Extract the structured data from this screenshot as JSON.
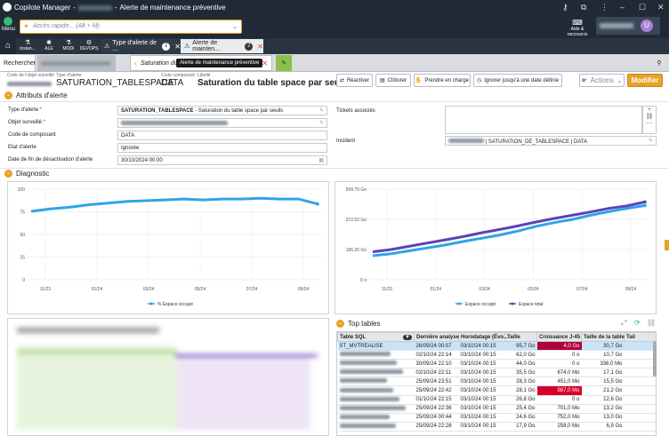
{
  "window": {
    "app_name": "Copilote Manager",
    "title_sep": "-",
    "title": "Alerte de maintenance préventive",
    "controls": [
      "–",
      "☐",
      "✕"
    ]
  },
  "topbar": {
    "menu_label": "Menu",
    "search_placeholder": "Accès rapide... (Alt + M)",
    "aide_label": "Aide & raccourcis",
    "avatar_letter": "U"
  },
  "app_tabs": [
    {
      "label": "Instan...",
      "icon": "⚗"
    },
    {
      "label": "ALE",
      "icon": "✱"
    },
    {
      "label": "MODI",
      "icon": "⚗"
    },
    {
      "label": "DEVOPS",
      "icon": "⚙"
    }
  ],
  "doc_tabs": [
    {
      "label": "Type d'alerte de ...",
      "count": "1"
    },
    {
      "label": "Alerte de mainten...",
      "count": "2"
    }
  ],
  "nav": {
    "search_tab": "Rechercher",
    "current_tab": "Saturation du",
    "tooltip": "Alerte de maintenance préventive"
  },
  "header": {
    "code_label": "Code de l'objet surveillé",
    "type_label": "Type d'alerte",
    "type_value": "SATURATION_TABLESPACE",
    "component_label": "Code composant",
    "component_value": "DATA",
    "libelle_label": "Libellé",
    "libelle_value": "Saturation du table space par seuils"
  },
  "actions": {
    "reactiver": "Réactiver",
    "cloturer": "Clôturer",
    "prendre": "Prendre en charge",
    "ignorer": "Ignorer jusqu'à une date définie",
    "actions": "Actions",
    "modifier": "Modifier"
  },
  "attributs": {
    "section_title": "Attributs d'alerte",
    "type_label": "Type d'alerte",
    "type_code": "SATURATION_TABLESPACE",
    "type_desc": " - Saturation du table space par seuils",
    "objet_label": "Objet surveillé",
    "composant_label": "Code de composant",
    "composant_value": "DATA",
    "etat_label": "Etat d'alerte",
    "etat_value": "Ignorée",
    "date_label": "Date de fin de désactivation d'alerte",
    "date_value": "30/10/2024 00:00",
    "tickets_label": "Tickets associés",
    "incident_label": "Incident",
    "incident_value": " | SATURATION_DE_TABLESPACE | DATA"
  },
  "diagnostic": {
    "section_title": "Diagnostic"
  },
  "chart_data": [
    {
      "type": "line",
      "x": [
        "11/23",
        "01/24",
        "03/24",
        "05/24",
        "07/24",
        "09/24"
      ],
      "series": [
        {
          "name": "% Espace occupé",
          "color": "#2fa3e8",
          "values": [
            83,
            86,
            88,
            91,
            93,
            95,
            96,
            97,
            98,
            97,
            98,
            98,
            99,
            98,
            98,
            92
          ]
        }
      ],
      "yticks": [
        "0",
        "25",
        "50",
        "75",
        "100"
      ],
      "ylim": [
        0,
        110
      ],
      "grid": true,
      "legend": "bottom"
    },
    {
      "type": "line",
      "x": [
        "11/23",
        "01/24",
        "03/24",
        "05/24",
        "07/24",
        "09/24"
      ],
      "series": [
        {
          "name": "Espace occupé",
          "color": "#2fa3e8",
          "values": [
            148,
            160,
            178,
            196,
            214,
            236,
            256,
            276,
            300,
            330,
            352,
            372,
            398,
            420,
            440,
            458
          ]
        },
        {
          "name": "Espace total",
          "color": "#5b43b9",
          "values": [
            172,
            186,
            206,
            226,
            246,
            266,
            290,
            310,
            332,
            356,
            378,
            398,
            418,
            440,
            456,
            480
          ]
        }
      ],
      "yticks": [
        "0 o",
        "186.26 Go",
        "372.53 Go",
        "558.79 Go"
      ],
      "ylim": [
        0,
        558.79
      ],
      "grid": true,
      "legend": "bottom"
    }
  ],
  "top_tables": {
    "section_title": "Top tables",
    "columns": [
      "Table SQL",
      "Dernière analyse",
      "Horodatage (Évo...",
      "Taille",
      "Croissance J-45",
      "Taille de la table",
      "Tail"
    ],
    "rows": [
      {
        "name": "ST_MVTREALISE",
        "d1": "26/09/24 00:07",
        "d2": "03/10/24 00:15",
        "taille": "95,7 Go",
        "croissance": "4,0 Go",
        "table": "30,7 Go",
        "hl": "darkred"
      },
      {
        "name": "",
        "d1": "02/10/24 22:14",
        "d2": "03/10/24 00:15",
        "taille": "62,0 Go",
        "croissance": "0 o",
        "table": "10,7 Go",
        "hl": ""
      },
      {
        "name": "",
        "d1": "30/09/24 22:10",
        "d2": "03/10/24 00:15",
        "taille": "44,0 Go",
        "croissance": "0 o",
        "table": "336,0 Mo",
        "hl": ""
      },
      {
        "name": "",
        "d1": "02/10/24 22:11",
        "d2": "03/10/24 00:15",
        "taille": "35,5 Go",
        "croissance": "674,0 Mo",
        "table": "17,1 Go",
        "hl": ""
      },
      {
        "name": "",
        "d1": "25/09/24 23:51",
        "d2": "03/10/24 00:15",
        "taille": "28,3 Go",
        "croissance": "451,0 Mo",
        "table": "15,5 Go",
        "hl": ""
      },
      {
        "name": "",
        "d1": "25/09/24 22:42",
        "d2": "03/10/24 00:15",
        "taille": "28,1 Go",
        "croissance": "987,0 Mo",
        "table": "21,2 Go",
        "hl": "red"
      },
      {
        "name": "",
        "d1": "01/10/24 22:15",
        "d2": "03/10/24 00:15",
        "taille": "26,8 Go",
        "croissance": "0 o",
        "table": "12,6 Go",
        "hl": ""
      },
      {
        "name": "",
        "d1": "25/09/24 22:36",
        "d2": "03/10/24 00:15",
        "taille": "25,4 Go",
        "croissance": "701,0 Mo",
        "table": "13,2 Go",
        "hl": ""
      },
      {
        "name": "",
        "d1": "25/09/24 00:44",
        "d2": "03/10/24 00:15",
        "taille": "24,6 Go",
        "croissance": "752,0 Mo",
        "table": "13,0 Go",
        "hl": ""
      },
      {
        "name": "",
        "d1": "25/09/24 22:28",
        "d2": "03/10/24 00:15",
        "taille": "17,9 Go",
        "croissance": "258,0 Mo",
        "table": "6,9 Go",
        "hl": ""
      }
    ]
  },
  "colors": {
    "accent": "#e9a128",
    "dark_bar": "#1f2a36",
    "line_blue": "#2fa3e8",
    "line_purple": "#5b43b9",
    "alert_red": "#d6002a"
  }
}
